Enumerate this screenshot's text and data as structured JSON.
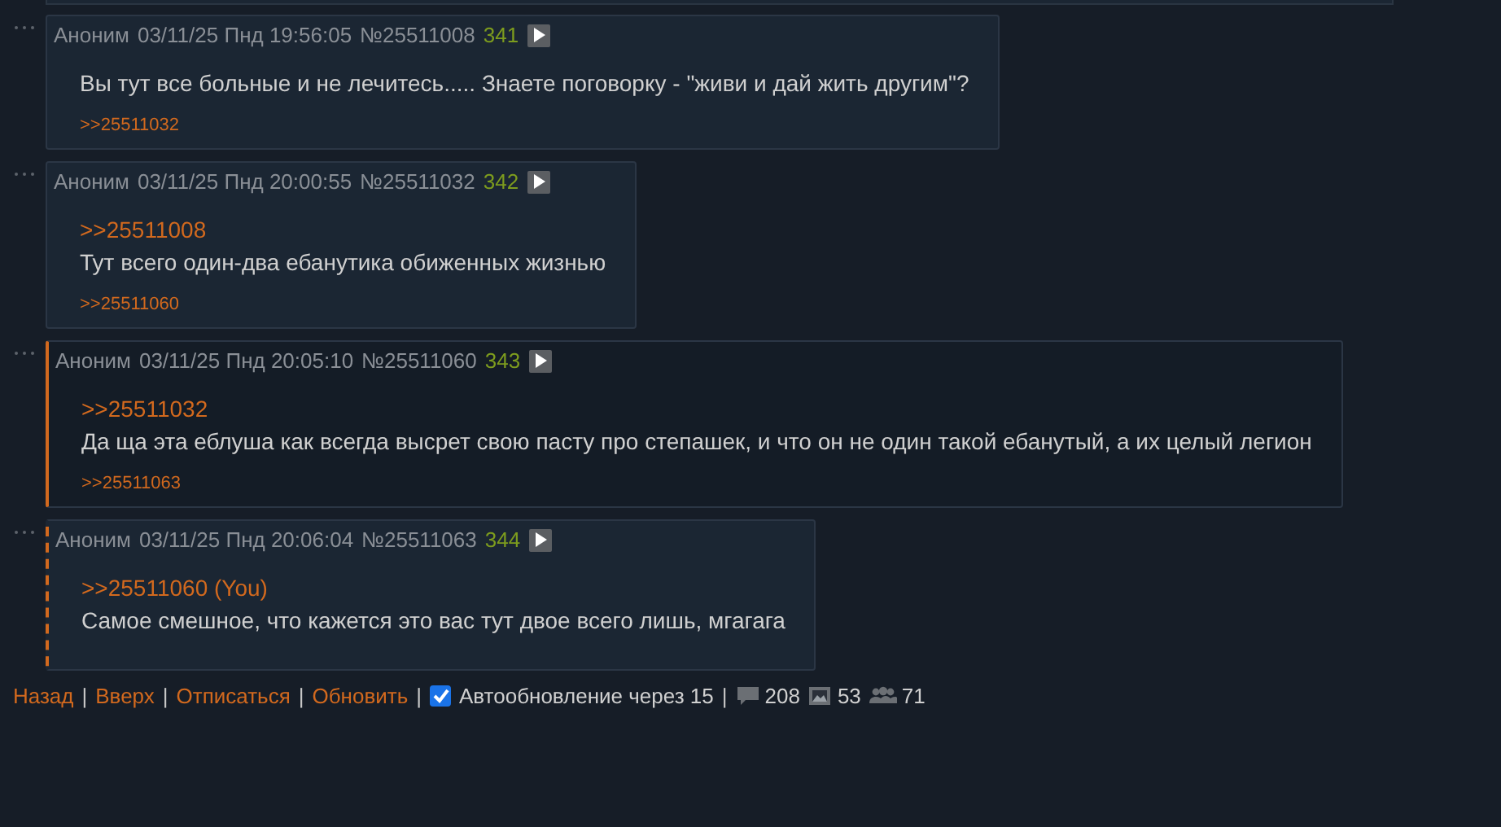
{
  "posts": [
    {
      "kind": "normal",
      "author": "Аноним",
      "date": "03/11/25 Пнд 19:56:05",
      "number": "№25511008",
      "ordinal": "341",
      "text": "Вы тут все больные и не лечитесь..... Знаете поговорку - \"живи и дай жить другим\"?",
      "backlinks": [
        ">>25511032"
      ]
    },
    {
      "kind": "normal",
      "author": "Аноним",
      "date": "03/11/25 Пнд 20:00:55",
      "number": "№25511032",
      "ordinal": "342",
      "reply_to": ">>25511008",
      "text": "Тут всего один-два ебанутика обиженных жизнью",
      "backlinks": [
        ">>25511060"
      ]
    },
    {
      "kind": "highlighted",
      "author": "Аноним",
      "date": "03/11/25 Пнд 20:05:10",
      "number": "№25511060",
      "ordinal": "343",
      "reply_to": ">>25511032",
      "text": "Да ща эта еблуша как всегда высрет свою пасту про степашек, и что он не один такой ебанутый, а их целый легион",
      "backlinks": [
        ">>25511063"
      ]
    },
    {
      "kind": "own",
      "author": "Аноним",
      "date": "03/11/25 Пнд 20:06:04",
      "number": "№25511063",
      "ordinal": "344",
      "reply_to": ">>25511060 (You)",
      "text": "Самое смешное, что кажется это вас тут двое всего лишь, мгагага"
    }
  ],
  "footer": {
    "separator": "|",
    "links": [
      "Назад",
      "Вверх",
      "Отписаться",
      "Обновить"
    ],
    "autoupdate": {
      "checked": true,
      "label": "Автообновление через 15"
    },
    "stats": [
      {
        "kind": "posts",
        "value": "208"
      },
      {
        "kind": "images",
        "value": "53"
      },
      {
        "kind": "posters",
        "value": "71"
      }
    ]
  }
}
